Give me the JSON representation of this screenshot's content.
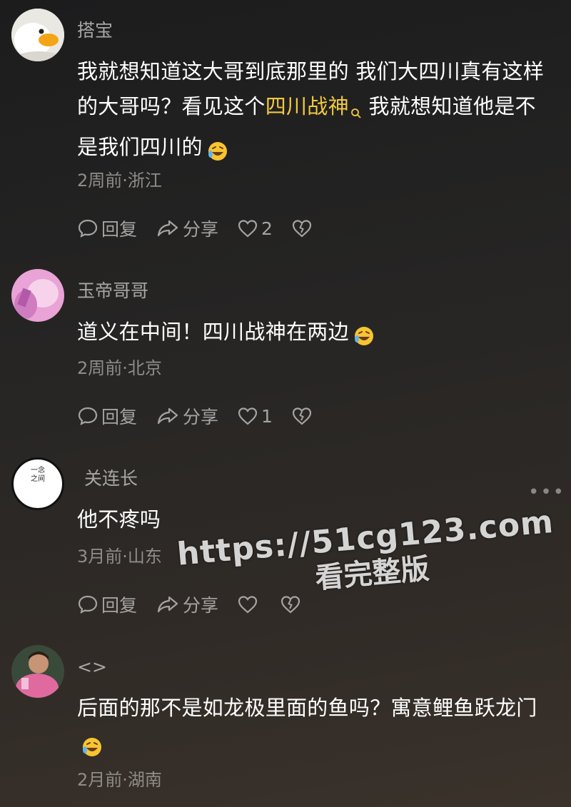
{
  "comments": [
    {
      "username": "搭宝",
      "text_parts": [
        "我就想知道这大哥到底那里的 我们大四川真有这样的大哥吗？看见这个",
        "四川战神",
        "我就想知道他是不是我们四川的"
      ],
      "meta": "2周前·浙江",
      "reply_label": "回复",
      "share_label": "分享",
      "like_count": "2"
    },
    {
      "username": "玉帝哥哥",
      "text": "道义在中间！四川战神在两边",
      "meta": "2周前·北京",
      "reply_label": "回复",
      "share_label": "分享",
      "like_count": "1"
    },
    {
      "username": "关连长",
      "avatar_text": "一念之间",
      "text": "他不疼吗",
      "meta": "3月前·山东",
      "reply_label": "回复",
      "share_label": "分享"
    },
    {
      "username": "<>",
      "text": "后面的那不是如龙极里面的鱼吗？寓意鲤鱼跃龙门",
      "meta": "2月前·湖南"
    }
  ],
  "watermark": {
    "url": "https://51cg123.com",
    "subtitle": "看完整版"
  },
  "icons": [
    "comment-icon",
    "share-icon",
    "heart-icon",
    "broken-heart-icon",
    "search-icon",
    "laughing-emoji-icon",
    "more-icon"
  ],
  "colors": {
    "highlight": "#f3c93f",
    "muted": "#8f8c89"
  }
}
